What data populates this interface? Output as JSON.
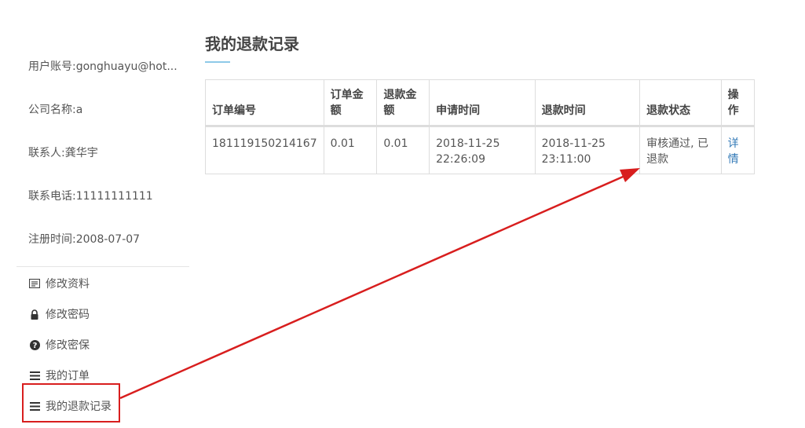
{
  "sidebar": {
    "account": "用户账号:gonghuayu@hot...",
    "company": "公司名称:a",
    "contact": "联系人:龚华宇",
    "phone": "联系电话:11111111111",
    "registered": "注册时间:2008-07-07",
    "menu": [
      {
        "label": "修改资料",
        "icon": "id-card-icon"
      },
      {
        "label": "修改密码",
        "icon": "lock-icon"
      },
      {
        "label": "修改密保",
        "icon": "question-circle-icon"
      },
      {
        "label": "我的订单",
        "icon": "list-icon"
      },
      {
        "label": "我的退款记录",
        "icon": "list-icon"
      }
    ]
  },
  "main": {
    "title": "我的退款记录",
    "table": {
      "headers": [
        "订单编号",
        "订单金额",
        "退款金额",
        "申请时间",
        "退款时间",
        "退款状态",
        "操作"
      ],
      "rows": [
        [
          "181119150214167",
          "0.01",
          "0.01",
          "2018-11-25 22:26:09",
          "2018-11-25 23:11:00",
          "审核通过, 已退款",
          "详情"
        ]
      ]
    }
  },
  "annotation": {
    "color": "#d81e1e"
  }
}
